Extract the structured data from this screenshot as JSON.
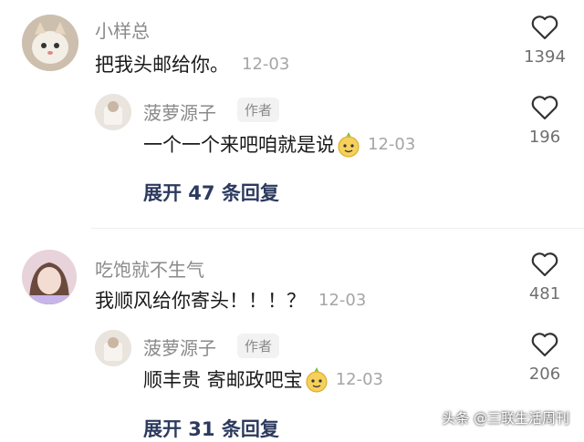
{
  "threads": [
    {
      "comment": {
        "author": "小样总",
        "text": "把我头邮给你。",
        "date": "12-03",
        "likes": "1394"
      },
      "reply": {
        "author": "菠萝源子",
        "badge": "作者",
        "text": "一个一个来吧咱就是说",
        "date": "12-03",
        "likes": "196",
        "emoji": "pineapple-emoji"
      },
      "expand_label": "展开 47 条回复"
    },
    {
      "comment": {
        "author": "吃饱就不生气",
        "text": "我顺风给你寄头！！！？",
        "date": "12-03",
        "likes": "481"
      },
      "reply": {
        "author": "菠萝源子",
        "badge": "作者",
        "text": "顺丰贵 寄邮政吧宝",
        "date": "12-03",
        "likes": "206",
        "emoji": "pineapple-emoji"
      },
      "expand_label": "展开 31 条回复"
    }
  ],
  "watermark": "头条 @三联生活周刊",
  "colors": {
    "expand": "#2c3a5e",
    "author": "#8a8a8a",
    "date": "#a5a5a5"
  }
}
